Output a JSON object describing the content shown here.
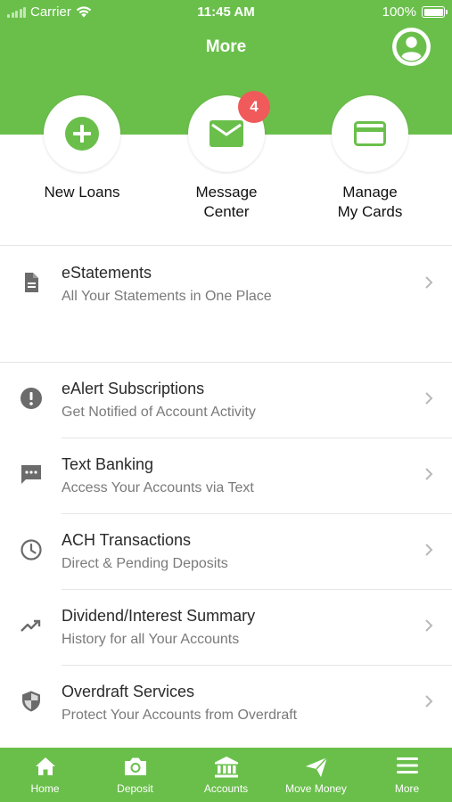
{
  "status_bar": {
    "carrier": "Carrier",
    "time": "11:45 AM",
    "battery": "100%"
  },
  "header": {
    "title": "More"
  },
  "quick_actions": [
    {
      "label_line1": "New Loans",
      "label_line2": ""
    },
    {
      "label_line1": "Message",
      "label_line2": "Center",
      "badge": "4"
    },
    {
      "label_line1": "Manage",
      "label_line2": "My Cards"
    }
  ],
  "list_items": [
    {
      "title": "eStatements",
      "subtitle": "All Your Statements in One Place",
      "icon": "document-icon"
    },
    {
      "title": "eAlert Subscriptions",
      "subtitle": "Get Notified of Account Activity",
      "icon": "alert-icon"
    },
    {
      "title": "Text Banking",
      "subtitle": "Access Your Accounts via Text",
      "icon": "chat-icon"
    },
    {
      "title": "ACH Transactions",
      "subtitle": "Direct & Pending Deposits",
      "icon": "clock-icon"
    },
    {
      "title": "Dividend/Interest Summary",
      "subtitle": "History for all Your Accounts",
      "icon": "trending-up-icon"
    },
    {
      "title": "Overdraft Services",
      "subtitle": "Protect Your Accounts from Overdraft",
      "icon": "shield-icon"
    }
  ],
  "tab_bar": [
    {
      "label": "Home",
      "icon": "home-icon"
    },
    {
      "label": "Deposit",
      "icon": "camera-icon"
    },
    {
      "label": "Accounts",
      "icon": "bank-icon"
    },
    {
      "label": "Move Money",
      "icon": "send-icon"
    },
    {
      "label": "More",
      "icon": "menu-icon"
    }
  ],
  "colors": {
    "brand_green": "#6abf4b",
    "badge_red": "#f05a5a",
    "icon_gray": "#6b6b6b"
  }
}
